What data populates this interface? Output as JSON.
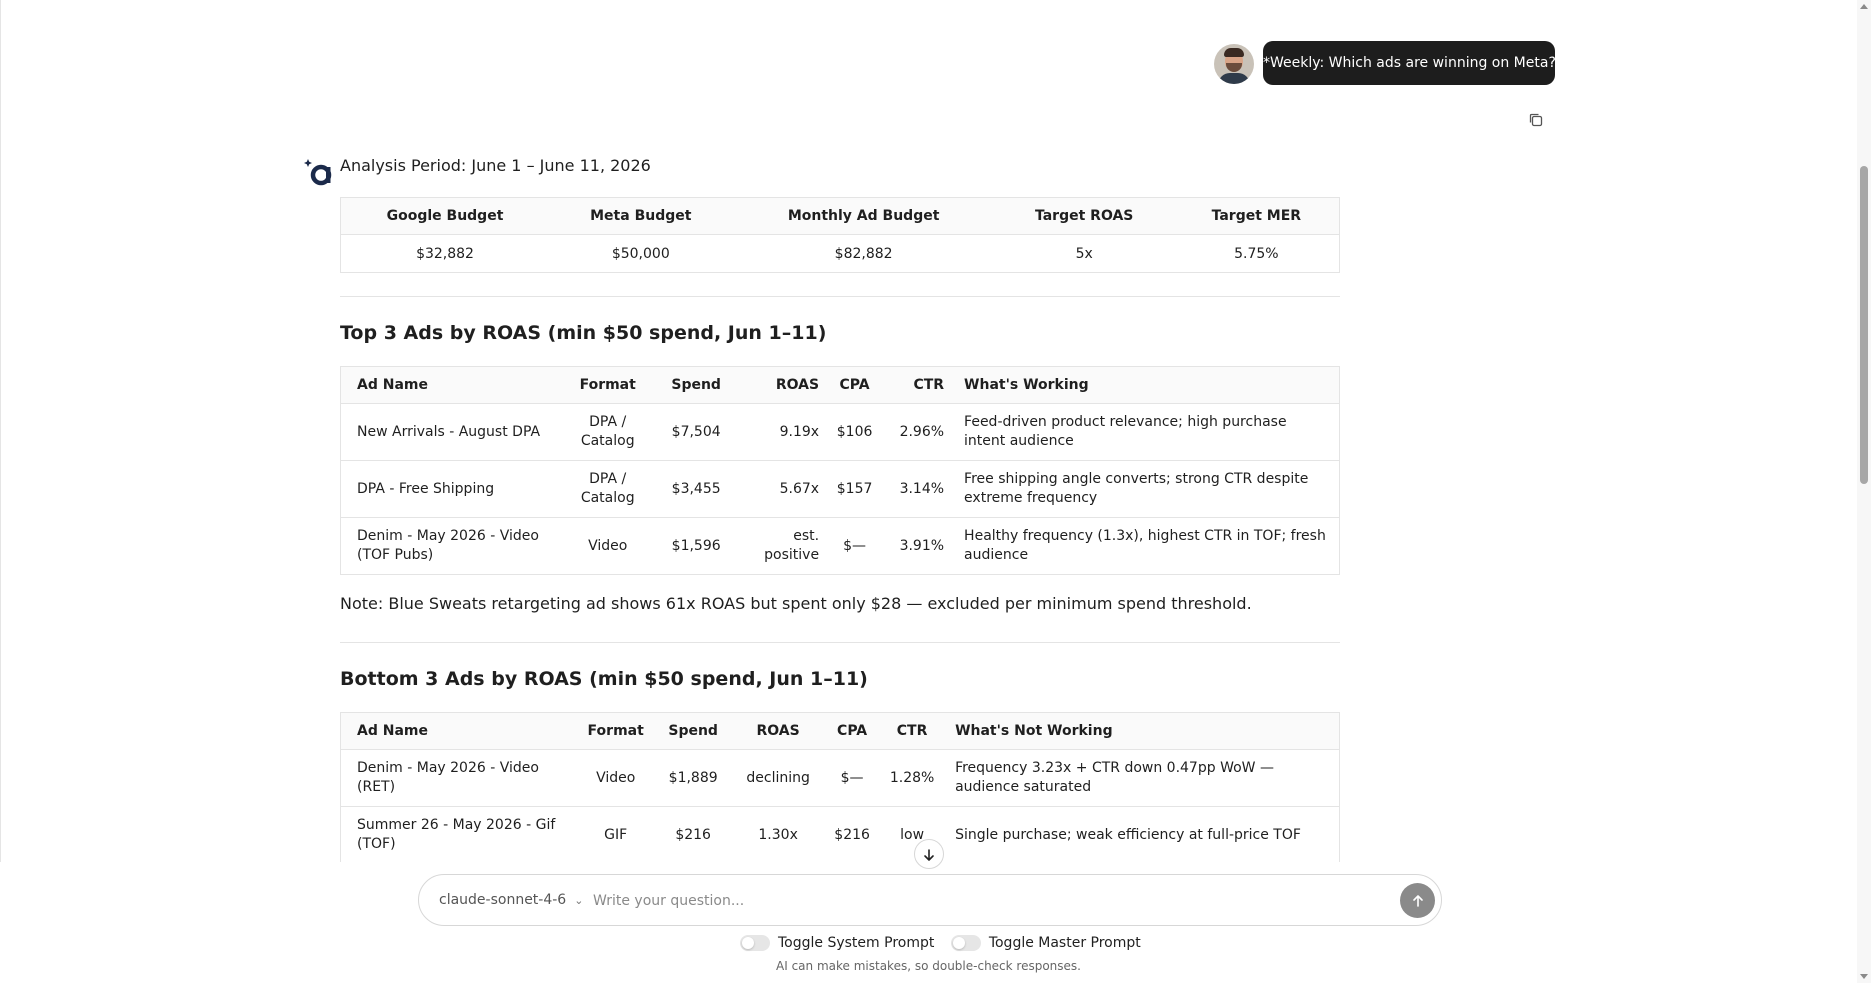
{
  "user_message": "*Weekly: Which ads are winning on Meta?",
  "analysis_period": "Analysis Period: June 1 – June 11, 2026",
  "budget_table": {
    "headers": [
      "Google Budget",
      "Meta Budget",
      "Monthly Ad Budget",
      "Target ROAS",
      "Target MER"
    ],
    "values": [
      "$32,882",
      "$50,000",
      "$82,882",
      "5x",
      "5.75%"
    ]
  },
  "top_section": {
    "title": "Top 3 Ads by ROAS (min $50 spend, Jun 1–11)",
    "headers": [
      "Ad Name",
      "Format",
      "Spend",
      "ROAS",
      "CPA",
      "CTR",
      "What's Working"
    ],
    "rows": [
      [
        "New Arrivals - August DPA",
        "DPA / Catalog",
        "$7,504",
        "9.19x",
        "$106",
        "2.96%",
        "Feed-driven product relevance; high purchase intent audience"
      ],
      [
        "DPA - Free Shipping",
        "DPA / Catalog",
        "$3,455",
        "5.67x",
        "$157",
        "3.14%",
        "Free shipping angle converts; strong CTR despite extreme frequency"
      ],
      [
        "Denim - May 2026 - Video (TOF Pubs)",
        "Video",
        "$1,596",
        "est. positive",
        "$—",
        "3.91%",
        "Healthy frequency (1.3x), highest CTR in TOF; fresh audience"
      ]
    ]
  },
  "note": "Note: Blue Sweats retargeting ad shows 61x ROAS but spent only $28 — excluded per minimum spend threshold.",
  "bottom_section": {
    "title": "Bottom 3 Ads by ROAS (min $50 spend, Jun 1–11)",
    "headers": [
      "Ad Name",
      "Format",
      "Spend",
      "ROAS",
      "CPA",
      "CTR",
      "What's Not Working"
    ],
    "rows": [
      [
        "Denim - May 2026 - Video (RET)",
        "Video",
        "$1,889",
        "declining",
        "$—",
        "1.28%",
        "Frequency 3.23x + CTR down 0.47pp WoW — audience saturated"
      ],
      [
        "Summer 26 - May 2026 - Gif (TOF)",
        "GIF",
        "$216",
        "1.30x",
        "$216",
        "low",
        "Single purchase; weak efficiency at full-price TOF"
      ]
    ]
  },
  "composer": {
    "model": "claude-sonnet-4-6",
    "placeholder": "Write your question..."
  },
  "toggles": {
    "system_prompt": "Toggle System Prompt",
    "master_prompt": "Toggle Master Prompt"
  },
  "disclaimer": "AI can make mistakes, so double-check responses.",
  "icons": {
    "copy": "copy-icon",
    "send": "arrow-up-icon",
    "scroll_down": "arrow-down-icon",
    "model_chevron": "chevron-down-icon",
    "bot": "assistant-logo-icon"
  },
  "colors": {
    "user_bubble": "#1d1d1d",
    "send_button": "#8a8a8a",
    "logo": "#1b2a4a"
  }
}
